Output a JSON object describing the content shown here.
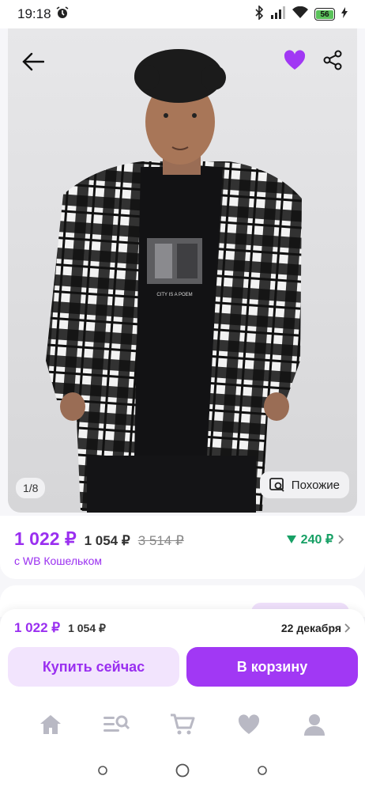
{
  "status_bar": {
    "time": "19:18",
    "battery": "56"
  },
  "gallery": {
    "counter": "1/8",
    "similar_label": "Похожие",
    "print_text": "CITY IS A POEM"
  },
  "price": {
    "main": "1 022 ₽",
    "secondary": "1 054 ₽",
    "old": "3 514 ₽",
    "delta": "240 ₽",
    "wallet_label": "с WB Кошельком"
  },
  "sticky": {
    "main": "1 022 ₽",
    "secondary": "1 054 ₽",
    "delivery": "22 декабря",
    "buy_now": "Купить сейчас",
    "to_cart": "В корзину"
  },
  "icons": {
    "back": "back-arrow-icon",
    "favorite": "heart-icon",
    "share": "share-icon",
    "similar": "image-search-icon",
    "home": "home-icon",
    "catalog": "catalog-search-icon",
    "cart": "cart-icon",
    "favorites": "heart-icon",
    "profile": "profile-icon"
  },
  "colors": {
    "accent": "#a138f4",
    "accent_text": "#9a2ff0",
    "accent_light": "#f2e4fd",
    "discount_green": "#17a065"
  }
}
